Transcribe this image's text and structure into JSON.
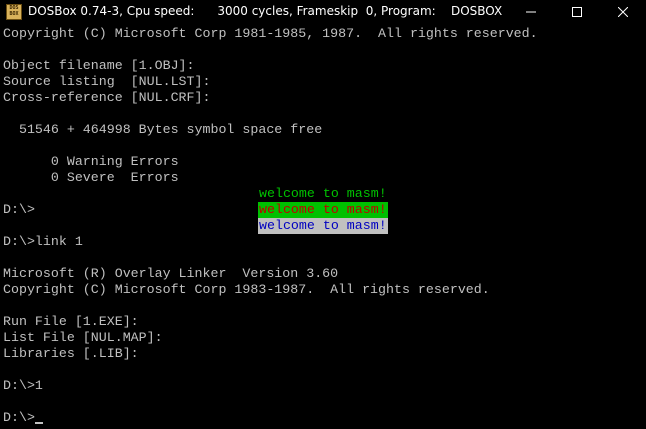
{
  "window": {
    "title": "DOSBox 0.74-3, Cpu speed:      3000 cycles, Frameskip  0, Program:    DOSBOX",
    "icon_label_top": "DOS",
    "icon_label_bottom": "BOX",
    "controls": [
      "minimize-icon",
      "maximize-icon",
      "close-icon"
    ]
  },
  "console": {
    "lines": [
      "Copyright (C) Microsoft Corp 1981-1985, 1987.  All rights reserved.",
      "",
      "Object filename [1.OBJ]:",
      "Source listing  [NUL.LST]:",
      "Cross-reference [NUL.CRF]:",
      "",
      "  51546 + 464998 Bytes symbol space free",
      "",
      "      0 Warning Errors",
      "      0 Severe  Errors",
      "",
      "D:\\>",
      "",
      "D:\\>link 1",
      "",
      "Microsoft (R) Overlay Linker  Version 3.60",
      "Copyright (C) Microsoft Corp 1983-1987.  All rights reserved.",
      "",
      "Run File [1.EXE]:",
      "List File [NUL.MAP]:",
      "Libraries [.LIB]:",
      "",
      "D:\\>1",
      "",
      "D:\\>"
    ],
    "banners": [
      {
        "text": "welcome to masm!",
        "fg": "#00c000",
        "bg": "#000000"
      },
      {
        "text": "welcome to masm!",
        "fg": "#c00000",
        "bg": "#00c000"
      },
      {
        "text": "welcome to masm!",
        "fg": "#0000c0",
        "bg": "#c0c0c0"
      }
    ],
    "text_color": "#c0c0c0",
    "background": "#000000"
  }
}
